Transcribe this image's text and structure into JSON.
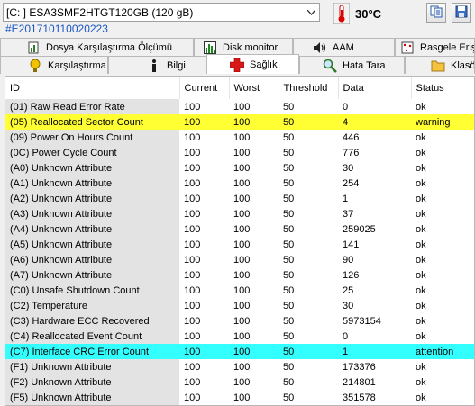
{
  "drive": {
    "selected": "[C: ] ESA3SMF2HTGT120GB (120 gB)",
    "serial": "#E201710110020223"
  },
  "temperature": {
    "value": "30°C",
    "icon": "thermometer-icon"
  },
  "toolbar": {
    "copy_icon": "copy-icon",
    "save_icon": "save-icon"
  },
  "tabs_row1": [
    {
      "label": "Dosya Karşılaştırma Ölçümü",
      "icon": "file-benchmark-icon"
    },
    {
      "label": "Disk monitor",
      "icon": "chart-icon"
    },
    {
      "label": "AAM",
      "icon": "speaker-icon"
    },
    {
      "label": "Rasgele Erişim",
      "icon": "random-access-icon"
    }
  ],
  "tabs_row2": [
    {
      "label": "Karşılaştırma",
      "icon": "benchmark-icon"
    },
    {
      "label": "Bilgi",
      "icon": "info-icon"
    },
    {
      "label": "Sağlık",
      "icon": "health-cross-icon",
      "active": true
    },
    {
      "label": "Hata Tara",
      "icon": "magnifier-icon"
    },
    {
      "label": "Klasör",
      "icon": "folder-icon"
    }
  ],
  "table": {
    "columns": [
      "ID",
      "Current",
      "Worst",
      "Threshold",
      "Data",
      "Status"
    ],
    "rows": [
      {
        "id": "(01) Raw Read Error Rate",
        "current": "100",
        "worst": "100",
        "threshold": "50",
        "data": "0",
        "status": "ok",
        "state": "ok"
      },
      {
        "id": "(05) Reallocated Sector Count",
        "current": "100",
        "worst": "100",
        "threshold": "50",
        "data": "4",
        "status": "warning",
        "state": "warning"
      },
      {
        "id": "(09) Power On Hours Count",
        "current": "100",
        "worst": "100",
        "threshold": "50",
        "data": "446",
        "status": "ok",
        "state": "ok"
      },
      {
        "id": "(0C) Power Cycle Count",
        "current": "100",
        "worst": "100",
        "threshold": "50",
        "data": "776",
        "status": "ok",
        "state": "ok"
      },
      {
        "id": "(A0) Unknown Attribute",
        "current": "100",
        "worst": "100",
        "threshold": "50",
        "data": "30",
        "status": "ok",
        "state": "ok"
      },
      {
        "id": "(A1) Unknown Attribute",
        "current": "100",
        "worst": "100",
        "threshold": "50",
        "data": "254",
        "status": "ok",
        "state": "ok"
      },
      {
        "id": "(A2) Unknown Attribute",
        "current": "100",
        "worst": "100",
        "threshold": "50",
        "data": "1",
        "status": "ok",
        "state": "ok"
      },
      {
        "id": "(A3) Unknown Attribute",
        "current": "100",
        "worst": "100",
        "threshold": "50",
        "data": "37",
        "status": "ok",
        "state": "ok"
      },
      {
        "id": "(A4) Unknown Attribute",
        "current": "100",
        "worst": "100",
        "threshold": "50",
        "data": "259025",
        "status": "ok",
        "state": "ok"
      },
      {
        "id": "(A5) Unknown Attribute",
        "current": "100",
        "worst": "100",
        "threshold": "50",
        "data": "141",
        "status": "ok",
        "state": "ok"
      },
      {
        "id": "(A6) Unknown Attribute",
        "current": "100",
        "worst": "100",
        "threshold": "50",
        "data": "90",
        "status": "ok",
        "state": "ok"
      },
      {
        "id": "(A7) Unknown Attribute",
        "current": "100",
        "worst": "100",
        "threshold": "50",
        "data": "126",
        "status": "ok",
        "state": "ok"
      },
      {
        "id": "(C0) Unsafe Shutdown Count",
        "current": "100",
        "worst": "100",
        "threshold": "50",
        "data": "25",
        "status": "ok",
        "state": "ok"
      },
      {
        "id": "(C2) Temperature",
        "current": "100",
        "worst": "100",
        "threshold": "50",
        "data": "30",
        "status": "ok",
        "state": "ok"
      },
      {
        "id": "(C3) Hardware ECC Recovered",
        "current": "100",
        "worst": "100",
        "threshold": "50",
        "data": "5973154",
        "status": "ok",
        "state": "ok"
      },
      {
        "id": "(C4) Reallocated Event Count",
        "current": "100",
        "worst": "100",
        "threshold": "50",
        "data": "0",
        "status": "ok",
        "state": "ok"
      },
      {
        "id": "(C7) Interface CRC Error Count",
        "current": "100",
        "worst": "100",
        "threshold": "50",
        "data": "1",
        "status": "attention",
        "state": "attention"
      },
      {
        "id": "(F1) Unknown Attribute",
        "current": "100",
        "worst": "100",
        "threshold": "50",
        "data": "173376",
        "status": "ok",
        "state": "ok"
      },
      {
        "id": "(F2) Unknown Attribute",
        "current": "100",
        "worst": "100",
        "threshold": "50",
        "data": "214801",
        "status": "ok",
        "state": "ok"
      },
      {
        "id": "(F5) Unknown Attribute",
        "current": "100",
        "worst": "100",
        "threshold": "50",
        "data": "351578",
        "status": "ok",
        "state": "ok"
      }
    ]
  },
  "colors": {
    "warning": "#ffff33",
    "attention": "#33ffff",
    "serial": "#1a56c6",
    "id_column": "#e3e3e3"
  }
}
